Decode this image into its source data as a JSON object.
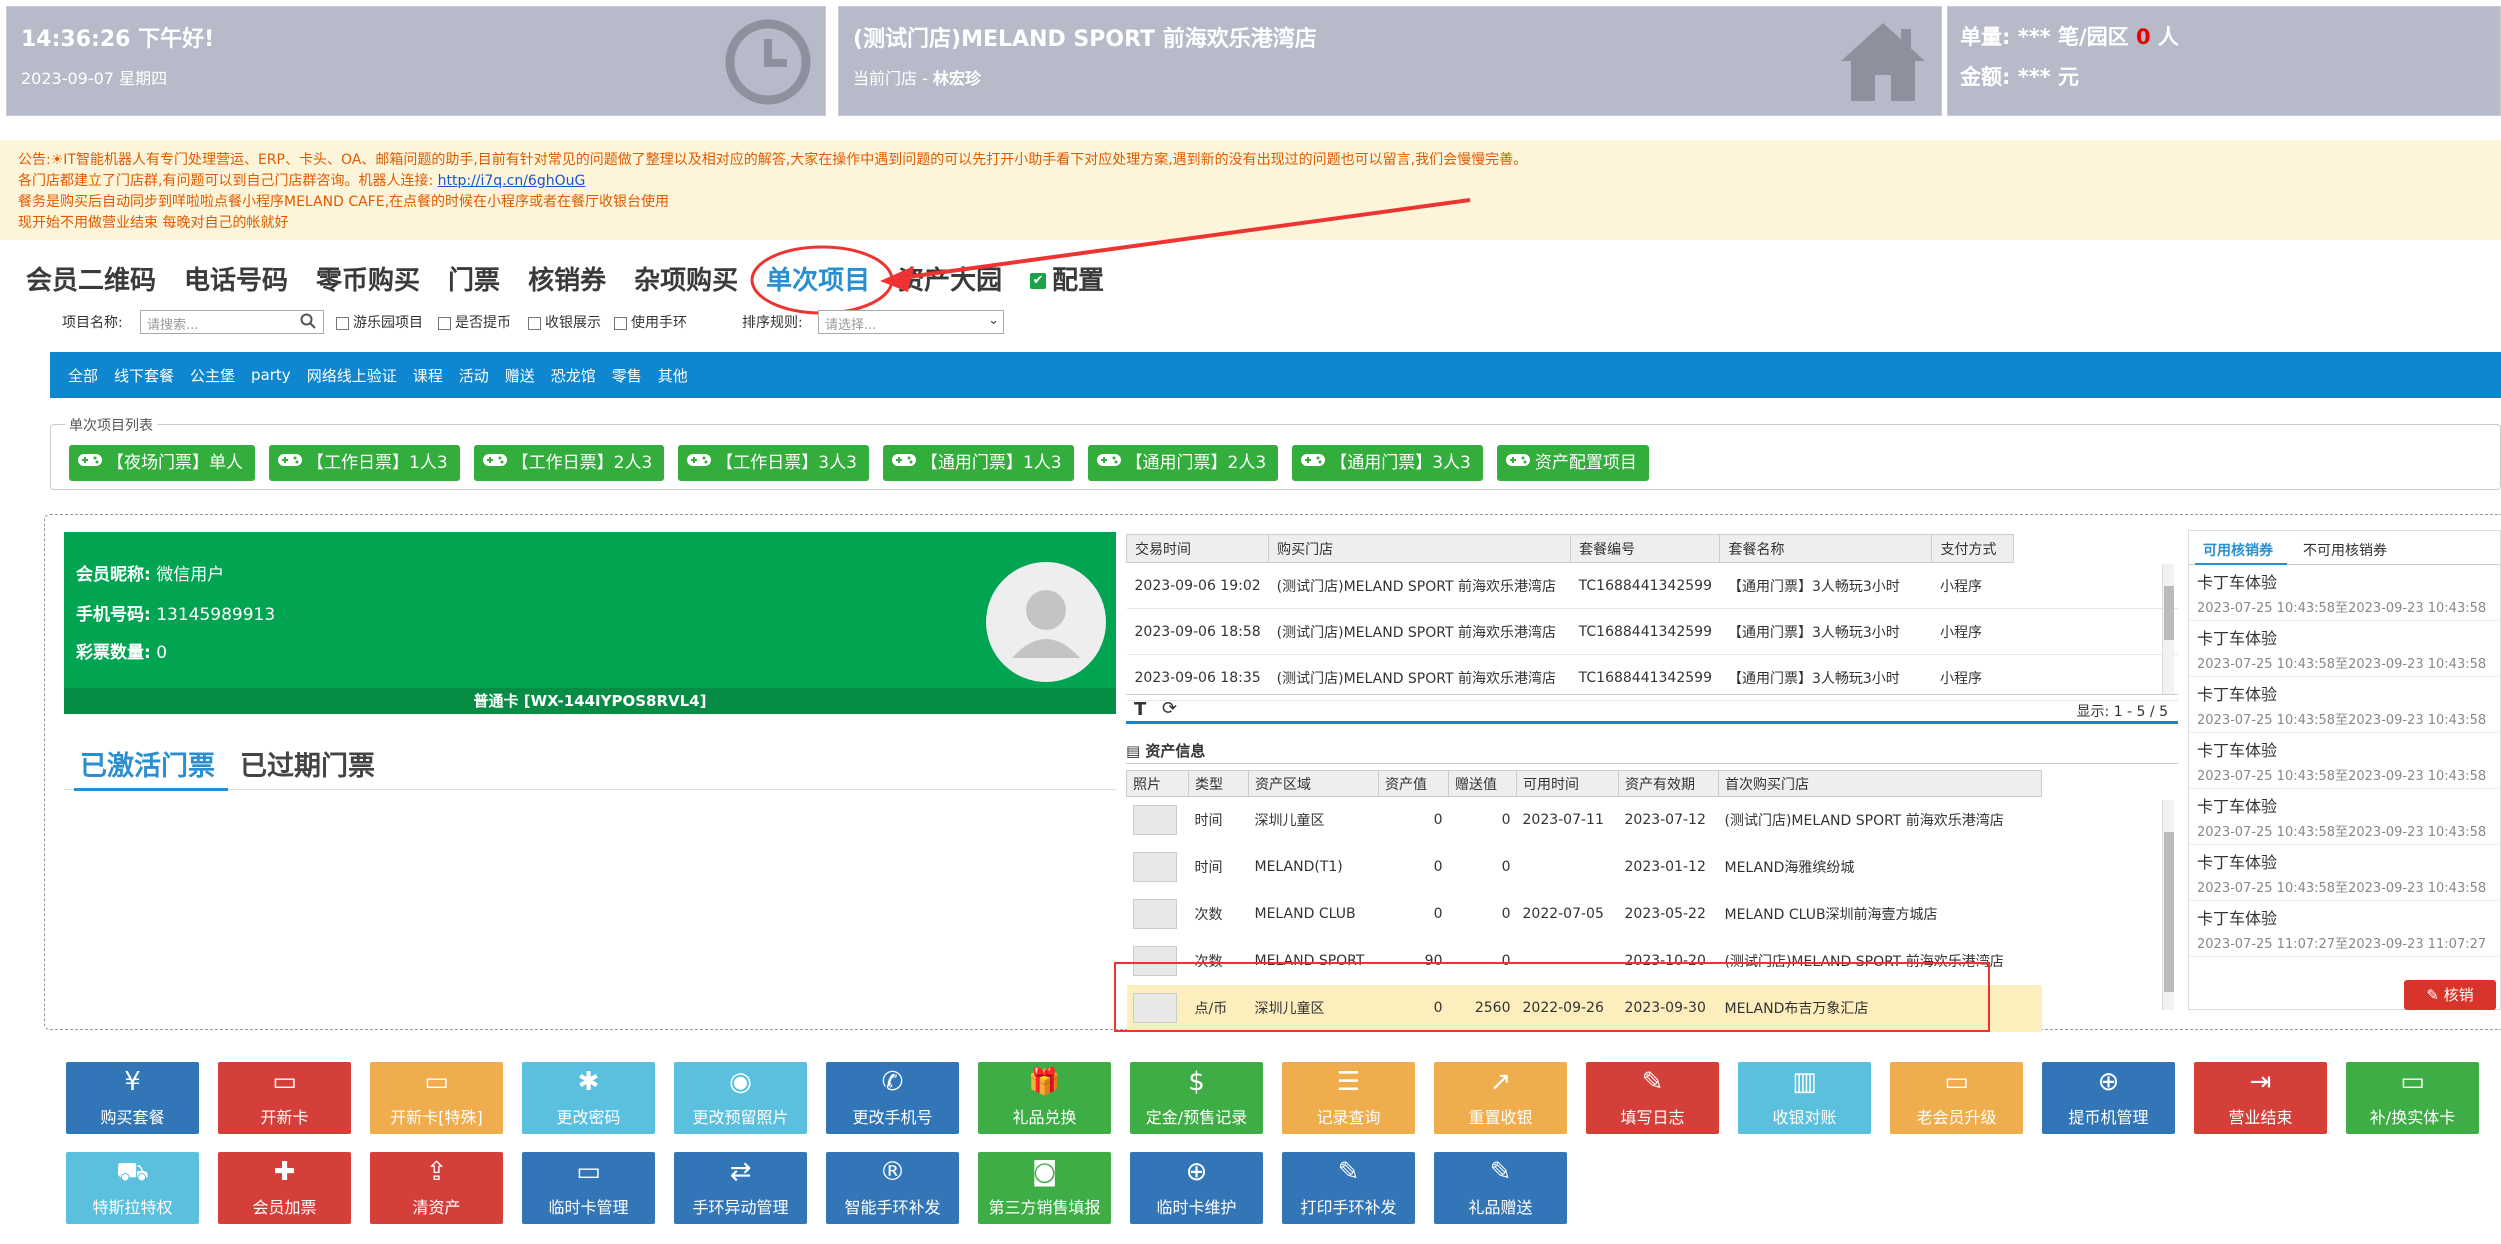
{
  "header": {
    "time_greeting": "14:36:26 下午好!",
    "date": "2023-09-07 星期四",
    "store_name": "(测试门店)MELAND SPORT 前海欢乐港湾店",
    "current_store_label": "当前门店 - ",
    "current_user": "林宏珍",
    "orders_label": "单量: *** 笔/园区 ",
    "orders_count": "0",
    "orders_unit": " 人",
    "amount_label": "金额: *** 元"
  },
  "notice": {
    "line1_prefix": "公告:",
    "line1": "IT智能机器人有专门处理营运、ERP、卡头、OA、邮箱问题的助手,目前有针对常见的问题做了整理以及相对应的解答,大家在操作中遇到问题的可以先打开小助手看下对应处理方案,遇到新的没有出现过的问题也可以留言,我们会慢慢完善。",
    "line2_prefix": "各门店都建立了门店群,有问题可以到自己门店群咨询。机器人连接: ",
    "line2_link": "http://i7q.cn/6ghOuG",
    "line3": "餐务是购买后自动同步到咩啦啦点餐小程序MELAND CAFE,在点餐的时候在小程序或者在餐厅收银台使用",
    "line4": "现开始不用做营业结束 每晚对自己的帐就好"
  },
  "nav_tabs": [
    "会员二维码",
    "电话号码",
    "零币购买",
    "门票",
    "核销券",
    "杂项购买",
    "单次项目",
    "资产大园",
    "配置"
  ],
  "filters": {
    "name_label": "项目名称:",
    "name_placeholder": "请搜索...",
    "chk1": "游乐园项目",
    "chk2": "是否提币",
    "chk3": "收银展示",
    "chk4": "使用手环",
    "sort_label": "排序规则:",
    "sort_placeholder": "请选择..."
  },
  "categories": [
    "全部",
    "线下套餐",
    "公主堡",
    "party",
    "网络线上验证",
    "课程",
    "活动",
    "赠送",
    "恐龙馆",
    "零售",
    "其他"
  ],
  "project_list": {
    "legend": "单次项目列表",
    "items": [
      "【夜场门票】单人",
      "【工作日票】1人3",
      "【工作日票】2人3",
      "【工作日票】3人3",
      "【通用门票】1人3",
      "【通用门票】2人3",
      "【通用门票】3人3",
      "资产配置项目"
    ]
  },
  "member": {
    "nick_label": "会员昵称:",
    "nick": "微信用户",
    "phone_label": "手机号码:",
    "phone": "13145989913",
    "tickets_label": "彩票数量:",
    "tickets": "0",
    "card": "普通卡 [WX-144IYPOS8RVL4]"
  },
  "ticket_tabs": {
    "active": "已激活门票",
    "expired": "已过期门票"
  },
  "orders": {
    "headers": [
      "交易时间",
      "购买门店",
      "套餐编号",
      "套餐名称",
      "支付方式"
    ],
    "rows": [
      [
        "2023-09-06 19:02",
        "(测试门店)MELAND SPORT 前海欢乐港湾店",
        "TC1688441342599",
        "【通用门票】3人畅玩3小时",
        "小程序"
      ],
      [
        "2023-09-06 18:58",
        "(测试门店)MELAND SPORT 前海欢乐港湾店",
        "TC1688441342599",
        "【通用门票】3人畅玩3小时",
        "小程序"
      ],
      [
        "2023-09-06 18:35",
        "(测试门店)MELAND SPORT 前海欢乐港湾店",
        "TC1688441342599",
        "【通用门票】3人畅玩3小时",
        "小程序"
      ]
    ],
    "pager": "显示: 1 - 5 / 5"
  },
  "assets": {
    "title": "资产信息",
    "headers": [
      "照片",
      "类型",
      "资产区域",
      "资产值",
      "赠送值",
      "可用时间",
      "资产有效期",
      "首次购买门店"
    ],
    "rows": [
      [
        "时间",
        "深圳儿童区",
        "0",
        "0",
        "2023-07-11",
        "2023-07-12",
        "(测试门店)MELAND SPORT 前海欢乐港湾店"
      ],
      [
        "时间",
        "MELAND(T1)",
        "0",
        "0",
        "",
        "2023-01-12",
        "MELAND海雅缤纷城"
      ],
      [
        "次数",
        "MELAND CLUB",
        "0",
        "0",
        "2022-07-05",
        "2023-05-22",
        "MELAND CLUB深圳前海壹方城店"
      ],
      [
        "次数",
        "MELAND SPORT",
        "90",
        "0",
        "",
        "2023-10-20",
        "(测试门店)MELAND SPORT 前海欢乐港湾店"
      ],
      [
        "点/币",
        "深圳儿童区",
        "0",
        "2560",
        "2022-09-26",
        "2023-09-30",
        "MELAND布吉万象汇店"
      ]
    ]
  },
  "coupons": {
    "tab_on": "可用核销券",
    "tab_off": "不可用核销券",
    "items": [
      {
        "name": "卡丁车体验",
        "dates": "2023-07-25 10:43:58至2023-09-23 10:43:58"
      },
      {
        "name": "卡丁车体验",
        "dates": "2023-07-25 10:43:58至2023-09-23 10:43:58"
      },
      {
        "name": "卡丁车体验",
        "dates": "2023-07-25 10:43:58至2023-09-23 10:43:58"
      },
      {
        "name": "卡丁车体验",
        "dates": "2023-07-25 10:43:58至2023-09-23 10:43:58"
      },
      {
        "name": "卡丁车体验",
        "dates": "2023-07-25 10:43:58至2023-09-23 10:43:58"
      },
      {
        "name": "卡丁车体验",
        "dates": "2023-07-25 10:43:58至2023-09-23 10:43:58"
      },
      {
        "name": "卡丁车体验",
        "dates": "2023-07-25 11:07:27至2023-09-23 11:07:27"
      }
    ],
    "redeem": "核销"
  },
  "actions_row1": [
    {
      "label": "购买套餐",
      "icon": "¥",
      "color": "bl"
    },
    {
      "label": "开新卡",
      "icon": "▭",
      "color": "rd"
    },
    {
      "label": "开新卡[特殊]",
      "icon": "▭",
      "color": "or"
    },
    {
      "label": "更改密码",
      "icon": "✱",
      "color": "cy"
    },
    {
      "label": "更改预留照片",
      "icon": "◉",
      "color": "cy"
    },
    {
      "label": "更改手机号",
      "icon": "✆",
      "color": "bl"
    },
    {
      "label": "礼品兑换",
      "icon": "🎁",
      "color": "gr"
    },
    {
      "label": "定金/预售记录",
      "icon": "$",
      "color": "gr"
    },
    {
      "label": "记录查询",
      "icon": "☰",
      "color": "or"
    },
    {
      "label": "重置收银",
      "icon": "↗",
      "color": "or"
    },
    {
      "label": "填写日志",
      "icon": "✎",
      "color": "rd"
    },
    {
      "label": "收银对账",
      "icon": "▥",
      "color": "cy"
    },
    {
      "label": "老会员升级",
      "icon": "▭",
      "color": "or"
    },
    {
      "label": "提币机管理",
      "icon": "⊕",
      "color": "bl"
    },
    {
      "label": "营业结束",
      "icon": "⇥",
      "color": "rd"
    },
    {
      "label": "补/换实体卡",
      "icon": "▭",
      "color": "gr"
    }
  ],
  "actions_row2": [
    {
      "label": "特斯拉特权",
      "icon": "⛟",
      "color": "cy"
    },
    {
      "label": "会员加票",
      "icon": "✚",
      "color": "rd"
    },
    {
      "label": "清资产",
      "icon": "⇪",
      "color": "rd"
    },
    {
      "label": "临时卡管理",
      "icon": "▭",
      "color": "bl"
    },
    {
      "label": "手环异动管理",
      "icon": "⇄",
      "color": "bl"
    },
    {
      "label": "智能手环补发",
      "icon": "®",
      "color": "bl"
    },
    {
      "label": "第三方销售填报",
      "icon": "◙",
      "color": "gr"
    },
    {
      "label": "临时卡维护",
      "icon": "⊕",
      "color": "bl"
    },
    {
      "label": "打印手环补发",
      "icon": "✎",
      "color": "bl"
    },
    {
      "label": "礼品赠送",
      "icon": "✎",
      "color": "bl"
    }
  ],
  "colors": {
    "accent": "#2a8fd0",
    "bar": "#0e86d0",
    "member_card": "#00a451",
    "header": "#b7bac8"
  }
}
